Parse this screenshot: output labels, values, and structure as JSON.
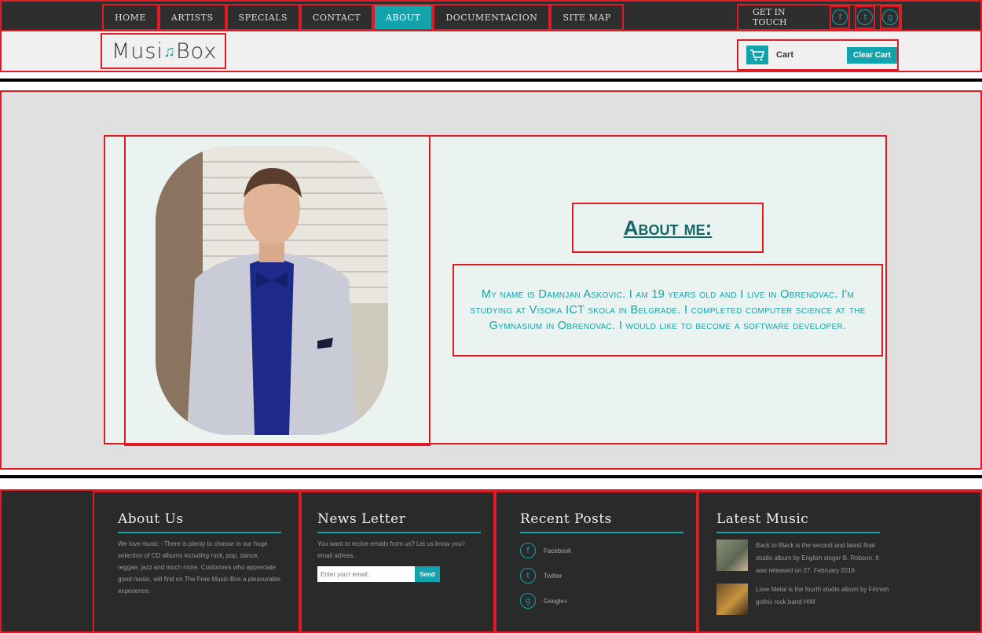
{
  "nav": {
    "items": [
      "Home",
      "Artists",
      "Specials",
      "Contact",
      "About",
      "Documentacion",
      "Site Map"
    ],
    "active": "About"
  },
  "touch": {
    "label": "Get in touch",
    "icons": [
      "facebook-icon",
      "tumblr-icon",
      "google-plus-icon"
    ],
    "glyphs": [
      "f",
      "t",
      "g"
    ]
  },
  "header": {
    "logo_part1": "Musi",
    "logo_part2": "Box",
    "cart_label": "Cart",
    "clear_cart": "Clear Cart"
  },
  "about": {
    "title": "About me:",
    "bio": "My name is Damnjan Askovic. I am 19 years old and I live in Obrenovac. I'm studying at Visoka ICT skola in Belgrade. I completed computer science at the Gymnasium in Obrenovac. I would like to become a software developer."
  },
  "footer": {
    "about_us": {
      "title": "About Us",
      "text": "We love music - There is plenty to choose in our huge selection of CD albums including rock, pop, dance, reggae, jazz and much more. Customers who appreciate good music, will find on The Free Music-Box a pleasurable experience."
    },
    "newsletter": {
      "title": "News Letter",
      "text": "You want to recive emails from us? Let us know you'r email adress..",
      "placeholder": "Enter you'r email..",
      "button": "Send"
    },
    "recent_posts": {
      "title": "Recent Posts",
      "items": [
        "Facebook",
        "Twitter",
        "Google+"
      ]
    },
    "latest_music": {
      "title": "Latest Music",
      "items": [
        "Back to Black is the second and latest final studio album by English singer B. Robson. It was released on 27. February 2019.",
        "Love Metal is the fourth studio album by Finnish gothic rock band HIM"
      ]
    }
  },
  "colors": {
    "accent": "#12a3ad",
    "dark": "#2e2e2e",
    "outline": "#e01b24"
  }
}
